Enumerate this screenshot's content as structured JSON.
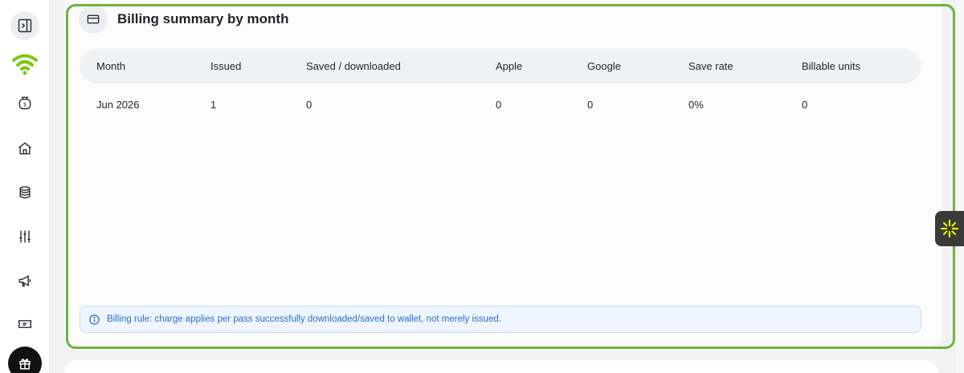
{
  "sidebar": {
    "items": [
      {
        "name": "panel-toggle-icon"
      },
      {
        "name": "wifi-logo-icon"
      },
      {
        "name": "money-bag-icon"
      },
      {
        "name": "home-icon"
      },
      {
        "name": "database-icon"
      },
      {
        "name": "sliders-icon"
      },
      {
        "name": "megaphone-icon"
      },
      {
        "name": "ticket-icon"
      },
      {
        "name": "gift-icon"
      }
    ],
    "brand_color": "#7cc80f"
  },
  "card": {
    "title": "Billing summary by month",
    "icon": "credit-card-icon",
    "outline_color": "#6db33f"
  },
  "table": {
    "columns": [
      "Month",
      "Issued",
      "Saved / downloaded",
      "Apple",
      "Google",
      "Save rate",
      "Billable units"
    ],
    "rows": [
      [
        "Jun 2026",
        "1",
        "0",
        "0",
        "0",
        "0%",
        "0"
      ]
    ]
  },
  "notice": {
    "icon": "info-circle-icon",
    "text": "Billing rule: charge applies per pass successfully downloaded/saved to wallet, not merely issued.",
    "color": "#2f6fc1"
  },
  "widget": {
    "icon": "sparkle-icon",
    "accent": "#e3f200"
  }
}
